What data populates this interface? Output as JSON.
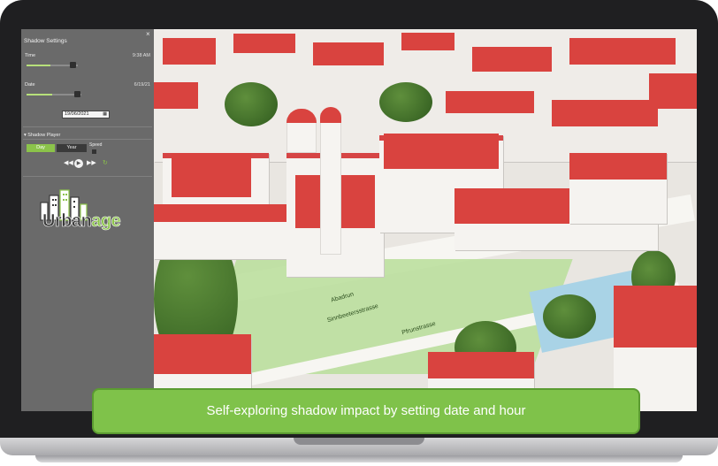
{
  "panel": {
    "title": "Shadow Settings",
    "close_symbol": "×",
    "time": {
      "label": "Time",
      "value": "9:38 AM",
      "slider_fraction": 0.46
    },
    "date": {
      "label": "Date",
      "value": "6/19/21",
      "slider_fraction": 0.47
    },
    "date_input": "19/06/2021",
    "player": {
      "title": "Shadow Player",
      "day_label": "Day",
      "year_label": "Year",
      "speed_label": "Speed",
      "controls": {
        "rewind": "◀◀",
        "play": "▶",
        "forward": "▶▶",
        "repeat": "↻"
      }
    },
    "logo": {
      "urban": "Urban",
      "age": "age"
    }
  },
  "map": {
    "street_1": "Abadrun",
    "street_2": "Sinnbeetersstrasse",
    "street_3": "Pfrunstrasse"
  },
  "caption": "Self-exploring shadow impact by setting date and hour",
  "colors": {
    "accent": "#8bc34a",
    "roof": "#d64545",
    "panel": "#6a6a6a",
    "park": "#b9de9a"
  }
}
